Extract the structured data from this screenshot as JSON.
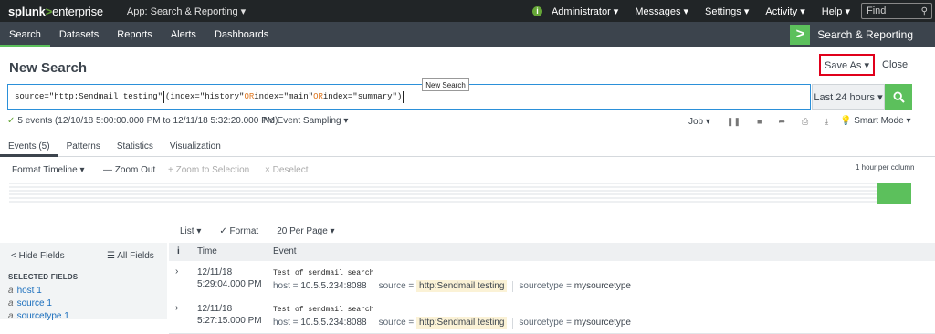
{
  "topbar": {
    "logo_main": "splunk",
    "logo_gt": ">",
    "logo_suffix": "enterprise",
    "app_menu": "App: Search & Reporting ▾",
    "info_icon": "info-icon",
    "menus": [
      "Administrator ▾",
      "Messages ▾",
      "Settings ▾",
      "Activity ▾",
      "Help ▾"
    ],
    "find_placeholder": "Find"
  },
  "nav": {
    "tabs": [
      "Search",
      "Datasets",
      "Reports",
      "Alerts",
      "Dashboards"
    ],
    "active": "Search",
    "app_title": "Search & Reporting",
    "app_logo": ">"
  },
  "page": {
    "title": "New Search",
    "save_as": "Save As ▾",
    "close": "Close",
    "tooltip": "New Search"
  },
  "search": {
    "query_parts": [
      {
        "t": "source=\"http:Sendmail testing\" ",
        "kw": false
      },
      {
        "t": "CARET",
        "kw": false
      },
      {
        "t": "(index=\"history\" ",
        "kw": false
      },
      {
        "t": "OR",
        "kw": true
      },
      {
        "t": " index=\"main\" ",
        "kw": false
      },
      {
        "t": "OR",
        "kw": true
      },
      {
        "t": " index=\"summary\")",
        "kw": false
      },
      {
        "t": "CARET",
        "kw": false
      }
    ],
    "time_range": "Last 24 hours ▾"
  },
  "status": {
    "events": "5 events (12/10/18 5:00:00.000 PM to 12/11/18 5:32:20.000 PM)",
    "sampling": "No Event Sampling ▾",
    "job": "Job ▾",
    "mode": "Smart Mode ▾"
  },
  "tabs": [
    "Events (5)",
    "Patterns",
    "Statistics",
    "Visualization"
  ],
  "timeline": {
    "format": "Format Timeline ▾",
    "zoom_out": "— Zoom Out",
    "zoom_sel": "+ Zoom to Selection",
    "deselect": "× Deselect",
    "scale": "1 hour per column"
  },
  "list": {
    "list": "List ▾",
    "format": "✓ Format",
    "per_page": "20 Per Page ▾"
  },
  "sidebar": {
    "hide": "< Hide Fields",
    "all": "☰ All Fields",
    "selected_header": "SELECTED FIELDS",
    "fields": [
      {
        "type": "a",
        "name": "host",
        "count": "1"
      },
      {
        "type": "a",
        "name": "source",
        "count": "1"
      },
      {
        "type": "a",
        "name": "sourcetype",
        "count": "1"
      }
    ]
  },
  "events_table": {
    "col_i": "i",
    "col_time": "Time",
    "col_event": "Event",
    "rows": [
      {
        "date": "12/11/18",
        "time": "5:29:04.000 PM",
        "raw": "Test of sendmail search",
        "host_label": "host =",
        "host": "10.5.5.234:8088",
        "source_label": "source =",
        "source": "http:Sendmail testing",
        "sourcetype_label": "sourcetype =",
        "sourcetype": "mysourcetype"
      },
      {
        "date": "12/11/18",
        "time": "5:27:15.000 PM",
        "raw": "Test of sendmail search",
        "host_label": "host =",
        "host": "10.5.5.234:8088",
        "source_label": "source =",
        "source": "http:Sendmail testing",
        "sourcetype_label": "sourcetype =",
        "sourcetype": "mysourcetype"
      }
    ]
  }
}
